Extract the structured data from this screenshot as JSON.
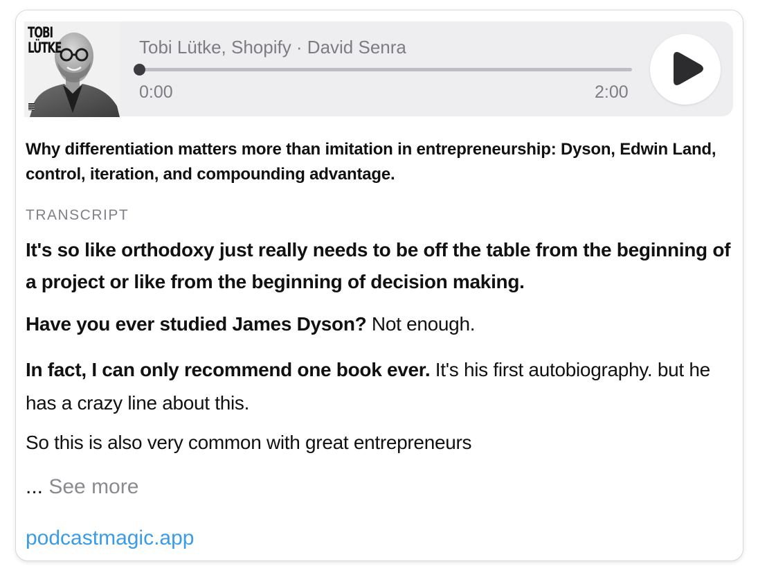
{
  "player": {
    "cover_title": "TOBI\nLÜTKE",
    "track_meta": "Tobi Lütke, Shopify · David Senra",
    "current_time": "0:00",
    "total_time": "2:00",
    "progress": 0,
    "play_icon": "play-icon"
  },
  "description": "Why differentiation matters more than imitation in entrepreneurship: Dyson, Edwin Land, control, iteration, and compounding advantage.",
  "transcript": {
    "label": "TRANSCRIPT",
    "p1": "It's so like orthodoxy just really needs to be off the table from the beginning of a project or like from the beginning of decision making.",
    "p2_bold": "Have you ever studied James Dyson?",
    "p2_rest": " Not enough.",
    "p3_bold": "In fact, I can only recommend one book ever.",
    "p3_rest": " It's his first autobiography. but he has a crazy line about this.",
    "p4": "So this is also very common with great entrepreneurs",
    "see_more_dots": "...",
    "see_more": " See more"
  },
  "footer": {
    "link": "podcastmagic.app"
  },
  "colors": {
    "link": "#3a9be6",
    "player_bg": "#eeeef0",
    "muted_text": "#7c7c83"
  }
}
